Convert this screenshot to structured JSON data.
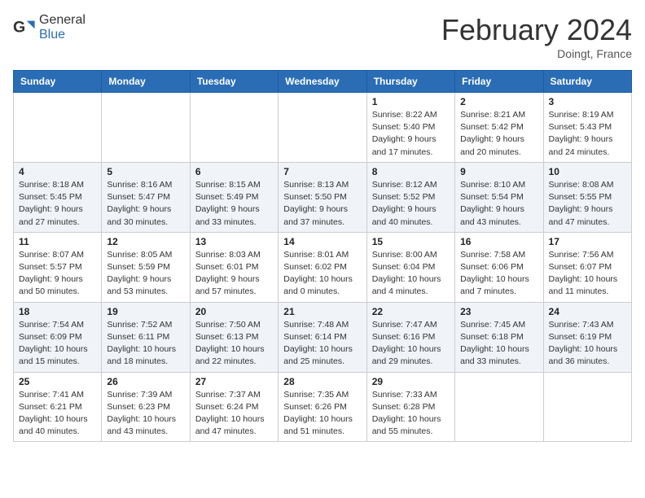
{
  "header": {
    "logo_general": "General",
    "logo_blue": "Blue",
    "month_title": "February 2024",
    "location": "Doingt, France"
  },
  "weekdays": [
    "Sunday",
    "Monday",
    "Tuesday",
    "Wednesday",
    "Thursday",
    "Friday",
    "Saturday"
  ],
  "weeks": [
    [
      {
        "day": "",
        "info": ""
      },
      {
        "day": "",
        "info": ""
      },
      {
        "day": "",
        "info": ""
      },
      {
        "day": "",
        "info": ""
      },
      {
        "day": "1",
        "info": "Sunrise: 8:22 AM\nSunset: 5:40 PM\nDaylight: 9 hours\nand 17 minutes."
      },
      {
        "day": "2",
        "info": "Sunrise: 8:21 AM\nSunset: 5:42 PM\nDaylight: 9 hours\nand 20 minutes."
      },
      {
        "day": "3",
        "info": "Sunrise: 8:19 AM\nSunset: 5:43 PM\nDaylight: 9 hours\nand 24 minutes."
      }
    ],
    [
      {
        "day": "4",
        "info": "Sunrise: 8:18 AM\nSunset: 5:45 PM\nDaylight: 9 hours\nand 27 minutes."
      },
      {
        "day": "5",
        "info": "Sunrise: 8:16 AM\nSunset: 5:47 PM\nDaylight: 9 hours\nand 30 minutes."
      },
      {
        "day": "6",
        "info": "Sunrise: 8:15 AM\nSunset: 5:49 PM\nDaylight: 9 hours\nand 33 minutes."
      },
      {
        "day": "7",
        "info": "Sunrise: 8:13 AM\nSunset: 5:50 PM\nDaylight: 9 hours\nand 37 minutes."
      },
      {
        "day": "8",
        "info": "Sunrise: 8:12 AM\nSunset: 5:52 PM\nDaylight: 9 hours\nand 40 minutes."
      },
      {
        "day": "9",
        "info": "Sunrise: 8:10 AM\nSunset: 5:54 PM\nDaylight: 9 hours\nand 43 minutes."
      },
      {
        "day": "10",
        "info": "Sunrise: 8:08 AM\nSunset: 5:55 PM\nDaylight: 9 hours\nand 47 minutes."
      }
    ],
    [
      {
        "day": "11",
        "info": "Sunrise: 8:07 AM\nSunset: 5:57 PM\nDaylight: 9 hours\nand 50 minutes."
      },
      {
        "day": "12",
        "info": "Sunrise: 8:05 AM\nSunset: 5:59 PM\nDaylight: 9 hours\nand 53 minutes."
      },
      {
        "day": "13",
        "info": "Sunrise: 8:03 AM\nSunset: 6:01 PM\nDaylight: 9 hours\nand 57 minutes."
      },
      {
        "day": "14",
        "info": "Sunrise: 8:01 AM\nSunset: 6:02 PM\nDaylight: 10 hours\nand 0 minutes."
      },
      {
        "day": "15",
        "info": "Sunrise: 8:00 AM\nSunset: 6:04 PM\nDaylight: 10 hours\nand 4 minutes."
      },
      {
        "day": "16",
        "info": "Sunrise: 7:58 AM\nSunset: 6:06 PM\nDaylight: 10 hours\nand 7 minutes."
      },
      {
        "day": "17",
        "info": "Sunrise: 7:56 AM\nSunset: 6:07 PM\nDaylight: 10 hours\nand 11 minutes."
      }
    ],
    [
      {
        "day": "18",
        "info": "Sunrise: 7:54 AM\nSunset: 6:09 PM\nDaylight: 10 hours\nand 15 minutes."
      },
      {
        "day": "19",
        "info": "Sunrise: 7:52 AM\nSunset: 6:11 PM\nDaylight: 10 hours\nand 18 minutes."
      },
      {
        "day": "20",
        "info": "Sunrise: 7:50 AM\nSunset: 6:13 PM\nDaylight: 10 hours\nand 22 minutes."
      },
      {
        "day": "21",
        "info": "Sunrise: 7:48 AM\nSunset: 6:14 PM\nDaylight: 10 hours\nand 25 minutes."
      },
      {
        "day": "22",
        "info": "Sunrise: 7:47 AM\nSunset: 6:16 PM\nDaylight: 10 hours\nand 29 minutes."
      },
      {
        "day": "23",
        "info": "Sunrise: 7:45 AM\nSunset: 6:18 PM\nDaylight: 10 hours\nand 33 minutes."
      },
      {
        "day": "24",
        "info": "Sunrise: 7:43 AM\nSunset: 6:19 PM\nDaylight: 10 hours\nand 36 minutes."
      }
    ],
    [
      {
        "day": "25",
        "info": "Sunrise: 7:41 AM\nSunset: 6:21 PM\nDaylight: 10 hours\nand 40 minutes."
      },
      {
        "day": "26",
        "info": "Sunrise: 7:39 AM\nSunset: 6:23 PM\nDaylight: 10 hours\nand 43 minutes."
      },
      {
        "day": "27",
        "info": "Sunrise: 7:37 AM\nSunset: 6:24 PM\nDaylight: 10 hours\nand 47 minutes."
      },
      {
        "day": "28",
        "info": "Sunrise: 7:35 AM\nSunset: 6:26 PM\nDaylight: 10 hours\nand 51 minutes."
      },
      {
        "day": "29",
        "info": "Sunrise: 7:33 AM\nSunset: 6:28 PM\nDaylight: 10 hours\nand 55 minutes."
      },
      {
        "day": "",
        "info": ""
      },
      {
        "day": "",
        "info": ""
      }
    ]
  ]
}
